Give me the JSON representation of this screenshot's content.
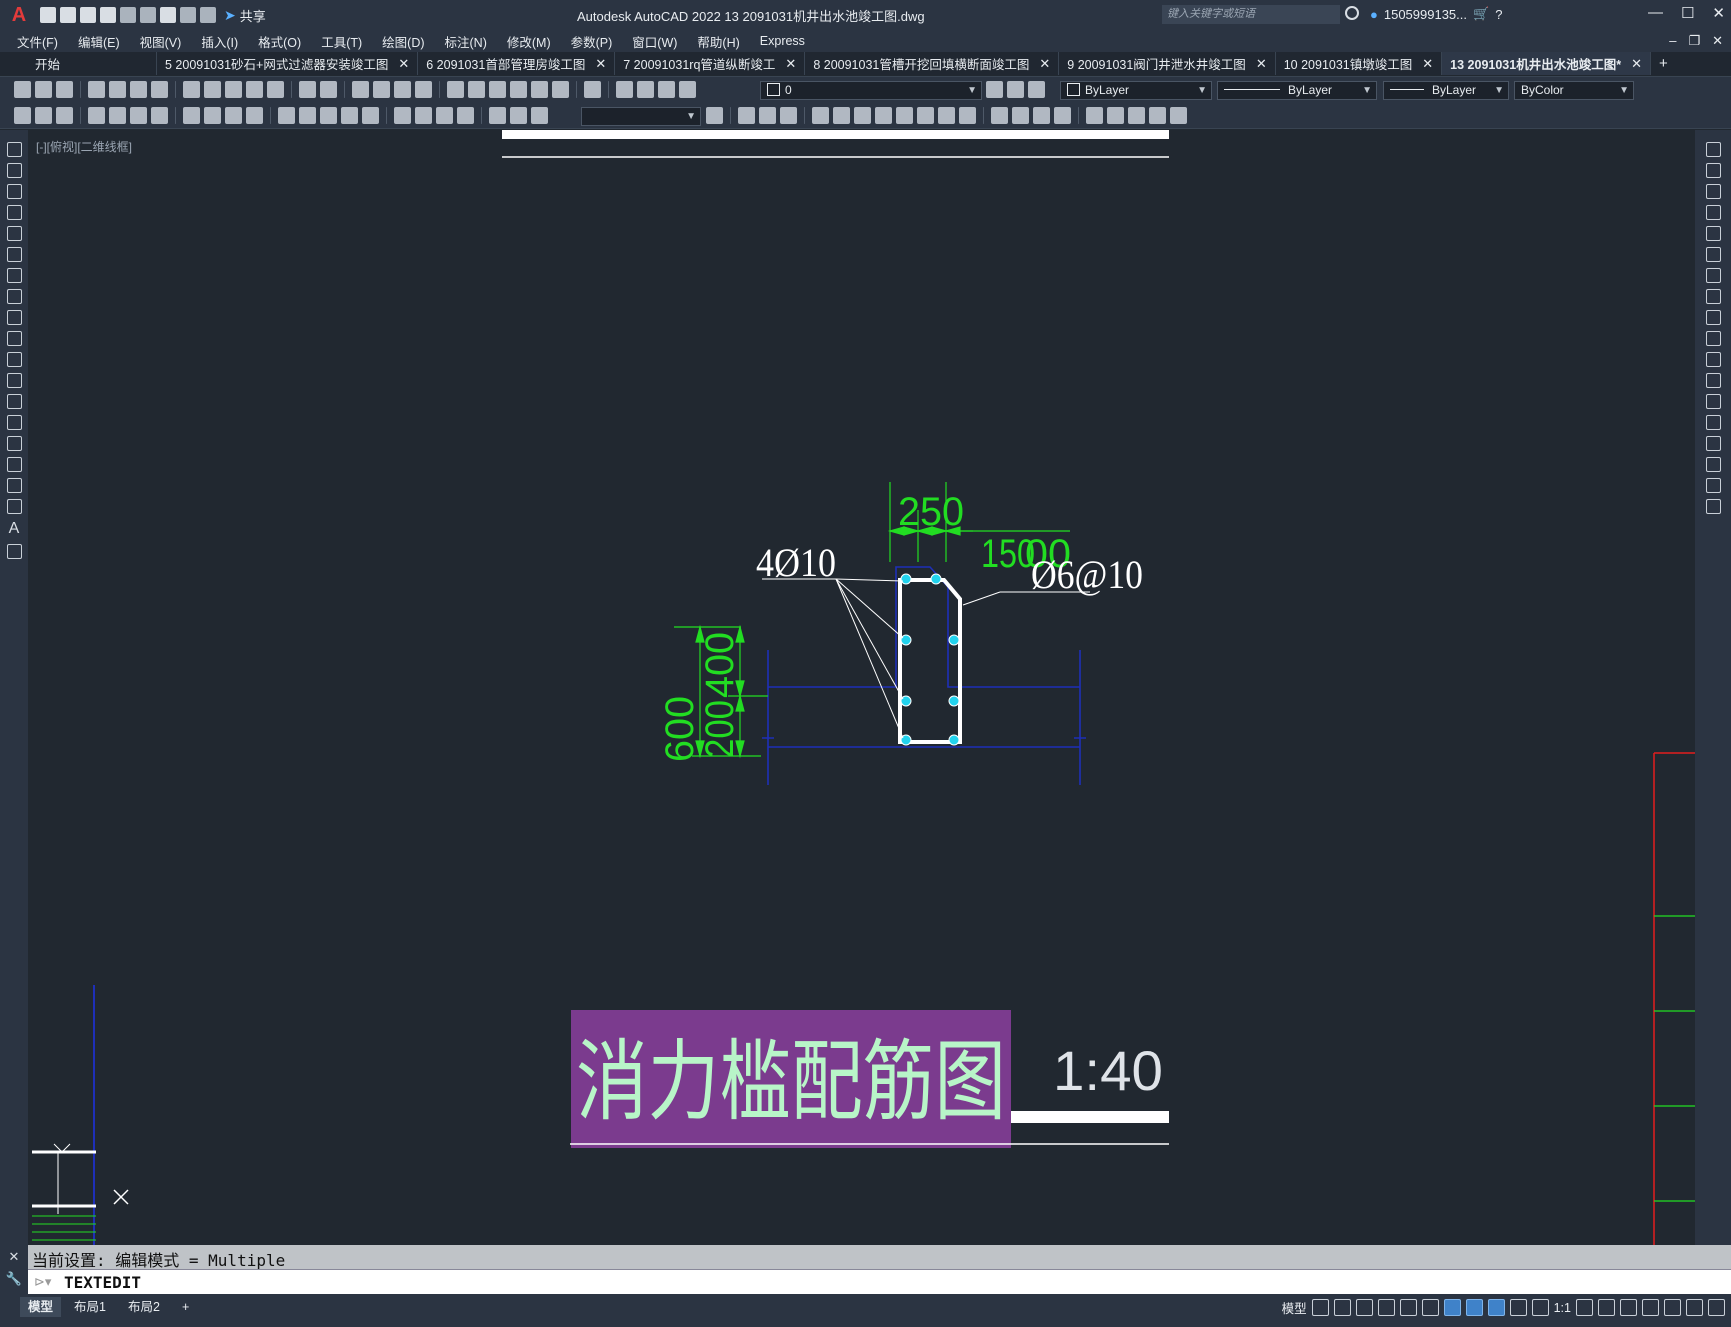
{
  "titlebar": {
    "app_title": "Autodesk AutoCAD 2022    13  2091031机井出水池竣工图.dwg",
    "share_label": "共享",
    "search_placeholder": "键入关键字或短语",
    "username": "1505999135..."
  },
  "menu": [
    "文件(F)",
    "编辑(E)",
    "视图(V)",
    "插入(I)",
    "格式(O)",
    "工具(T)",
    "绘图(D)",
    "标注(N)",
    "修改(M)",
    "参数(P)",
    "窗口(W)",
    "帮助(H)",
    "Express"
  ],
  "tabs": [
    {
      "label": "开始",
      "closable": false,
      "active": false
    },
    {
      "label": "5  20091031砂石+网式过滤器安装竣工图",
      "closable": true,
      "active": false
    },
    {
      "label": "6  2091031首部管理房竣工图",
      "closable": true,
      "active": false
    },
    {
      "label": "7  20091031rq管道纵断竣工",
      "closable": true,
      "active": false
    },
    {
      "label": "8  20091031管槽开挖回填横断面竣工图",
      "closable": true,
      "active": false
    },
    {
      "label": "9  20091031阀门井泄水井竣工图",
      "closable": true,
      "active": false
    },
    {
      "label": "10  2091031镇墩竣工图",
      "closable": true,
      "active": false
    },
    {
      "label": "13  2091031机井出水池竣工图*",
      "closable": true,
      "active": true
    }
  ],
  "properties": {
    "layer": "0",
    "color": "ByLayer",
    "linetype": "ByLayer",
    "lineweight": "ByLayer",
    "plotstyle": "ByColor"
  },
  "viewport": {
    "label": "[-][俯视][二维线框]"
  },
  "drawing": {
    "dim_250": "250",
    "dim_150": "150",
    "dim_100": "00",
    "dim_600": "600",
    "dim_400": "400",
    "dim_200": "200",
    "rebar_main": "4Ø10",
    "rebar_stirrup": "Ø6@10",
    "title": "消力槛配筋图",
    "scale": "1:40"
  },
  "command": {
    "history": "当前设置: 编辑模式 = Multiple",
    "current": "TEXTEDIT"
  },
  "status": {
    "layout_tabs": [
      "模型",
      "布局1",
      "布局2"
    ],
    "model_label": "模型",
    "scale_label": "1:1"
  }
}
